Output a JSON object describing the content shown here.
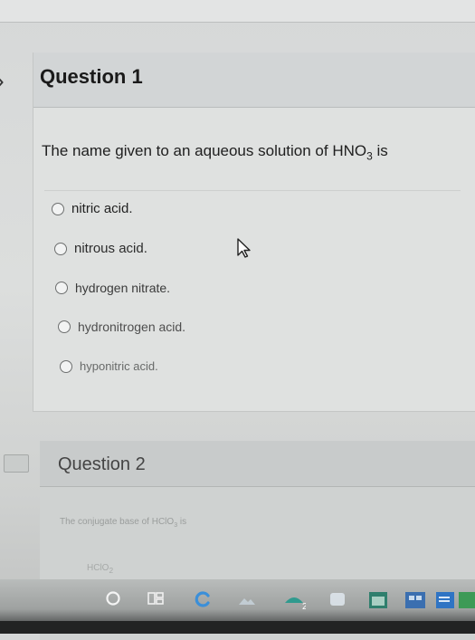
{
  "question1": {
    "title": "Question 1",
    "prompt_before": "The name given to an aqueous solution of HNO",
    "prompt_sub": "3",
    "prompt_after": " is",
    "options": [
      {
        "label": "nitric acid."
      },
      {
        "label": "nitrous acid."
      },
      {
        "label": "hydrogen nitrate."
      },
      {
        "label": "hydronitrogen acid."
      },
      {
        "label": "hyponitric acid."
      }
    ]
  },
  "question2": {
    "title": "Question 2",
    "prompt_before": "The conjugate base of HClO",
    "prompt_sub": "3",
    "prompt_after": " is",
    "first_option": "HClO",
    "first_option_sub": "2"
  },
  "taskbar": {
    "icons": [
      "search-circle-icon",
      "task-view-icon",
      "browser-icon",
      "photos-icon",
      "outlook-icon",
      "cortana-icon",
      "calendar-icon",
      "windows-store-icon",
      "word-icon",
      "excel-icon"
    ],
    "badge": "2"
  },
  "colors": {
    "card_background": "#dfe1e0",
    "header_background": "#d2d5d6",
    "text_primary": "#1a1a1a",
    "taskbar_accent_teal": "#2f9a8e",
    "taskbar_accent_blue": "#3b6fb0"
  }
}
